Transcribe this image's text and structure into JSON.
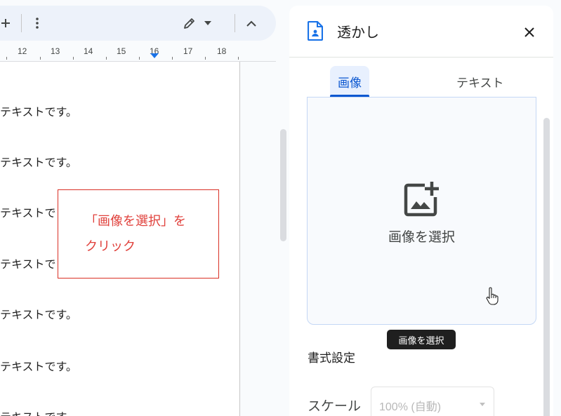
{
  "toolbar": {
    "add_icon": "plus-icon",
    "more_icon": "more-vert-icon",
    "mode_icon": "pencil-icon",
    "mode_dropdown_icon": "arrow-drop-down-icon",
    "collapse_icon": "chevron-up-icon"
  },
  "ruler": {
    "numbers": [
      "12",
      "13",
      "14",
      "15",
      "16",
      "17",
      "18"
    ],
    "marker_color": "#1a73e8"
  },
  "document": {
    "lines": [
      "テキストです。",
      "テキストです。",
      "テキストで",
      "テキストで",
      "テキストです。",
      "テキストです。",
      "テキストです。"
    ],
    "callout": {
      "line1": "「画像を選択」を",
      "line2": "クリック",
      "color": "#d93025"
    }
  },
  "panel": {
    "icon": "watermark-doc-icon",
    "title": "透かし",
    "close_icon": "close-icon",
    "tabs": [
      {
        "label": "画像",
        "active": true
      },
      {
        "label": "テキスト",
        "active": false
      }
    ],
    "dropzone": {
      "icon": "add-photo-icon",
      "label": "画像を選択"
    },
    "tooltip": "画像を選択",
    "formatting_heading": "書式設定",
    "scale": {
      "label": "スケール",
      "value": "100% (自動)"
    },
    "accent_color": "#0b57d0"
  }
}
